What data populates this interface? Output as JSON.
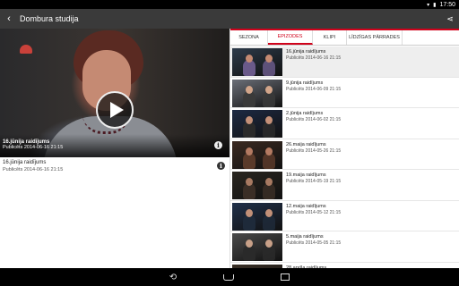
{
  "status_bar": {
    "time": "17:50",
    "wifi_icon": "wifi-icon",
    "battery_icon": "battery-icon"
  },
  "app_bar": {
    "title": "Dombura studija",
    "back_icon": "back-arrow-icon",
    "share_icon": "share-icon"
  },
  "player": {
    "title": "16.jūnija raidījums",
    "date": "Publicēts 2014-06-16 21:15",
    "play_icon": "play-icon",
    "info_icon": "info-icon"
  },
  "details": {
    "title": "16.jūnija raidījums",
    "date": "Publicēts 2014-06-16 21:15"
  },
  "tabs": [
    {
      "label": "SEZONA",
      "active": false
    },
    {
      "label": "EPIZODES",
      "active": true
    },
    {
      "label": "KLIPI",
      "active": false
    },
    {
      "label": "LĪDZĪGAS PĀRRADES",
      "active": false
    }
  ],
  "episodes": [
    {
      "title": "16.jūnija raidījums",
      "date": "Publicēts 2014-06-16 21:15",
      "selected": true
    },
    {
      "title": "9.jūnija raidījums",
      "date": "Publicēts 2014-06-09 21:15",
      "selected": false
    },
    {
      "title": "2.jūnija raidījums",
      "date": "Publicēts 2014-06-02 21:15",
      "selected": false
    },
    {
      "title": "26.maija raidījums",
      "date": "Publicēts 2014-05-26 21:15",
      "selected": false
    },
    {
      "title": "19.maija raidījums",
      "date": "Publicēts 2014-05-19 21:15",
      "selected": false
    },
    {
      "title": "12.maija raidījums",
      "date": "Publicēts 2014-05-12 21:15",
      "selected": false
    },
    {
      "title": "5.maija raidījums",
      "date": "Publicēts 2014-05-05 21:15",
      "selected": false
    },
    {
      "title": "28.aprīļa raidījums",
      "date": "",
      "selected": false
    }
  ],
  "colors": {
    "accent": "#d0021b",
    "app_bar": "#3a3a3a"
  },
  "nav_bar": {
    "back_icon": "nav-back-icon",
    "home_icon": "nav-home-icon",
    "recents_icon": "nav-recents-icon"
  }
}
